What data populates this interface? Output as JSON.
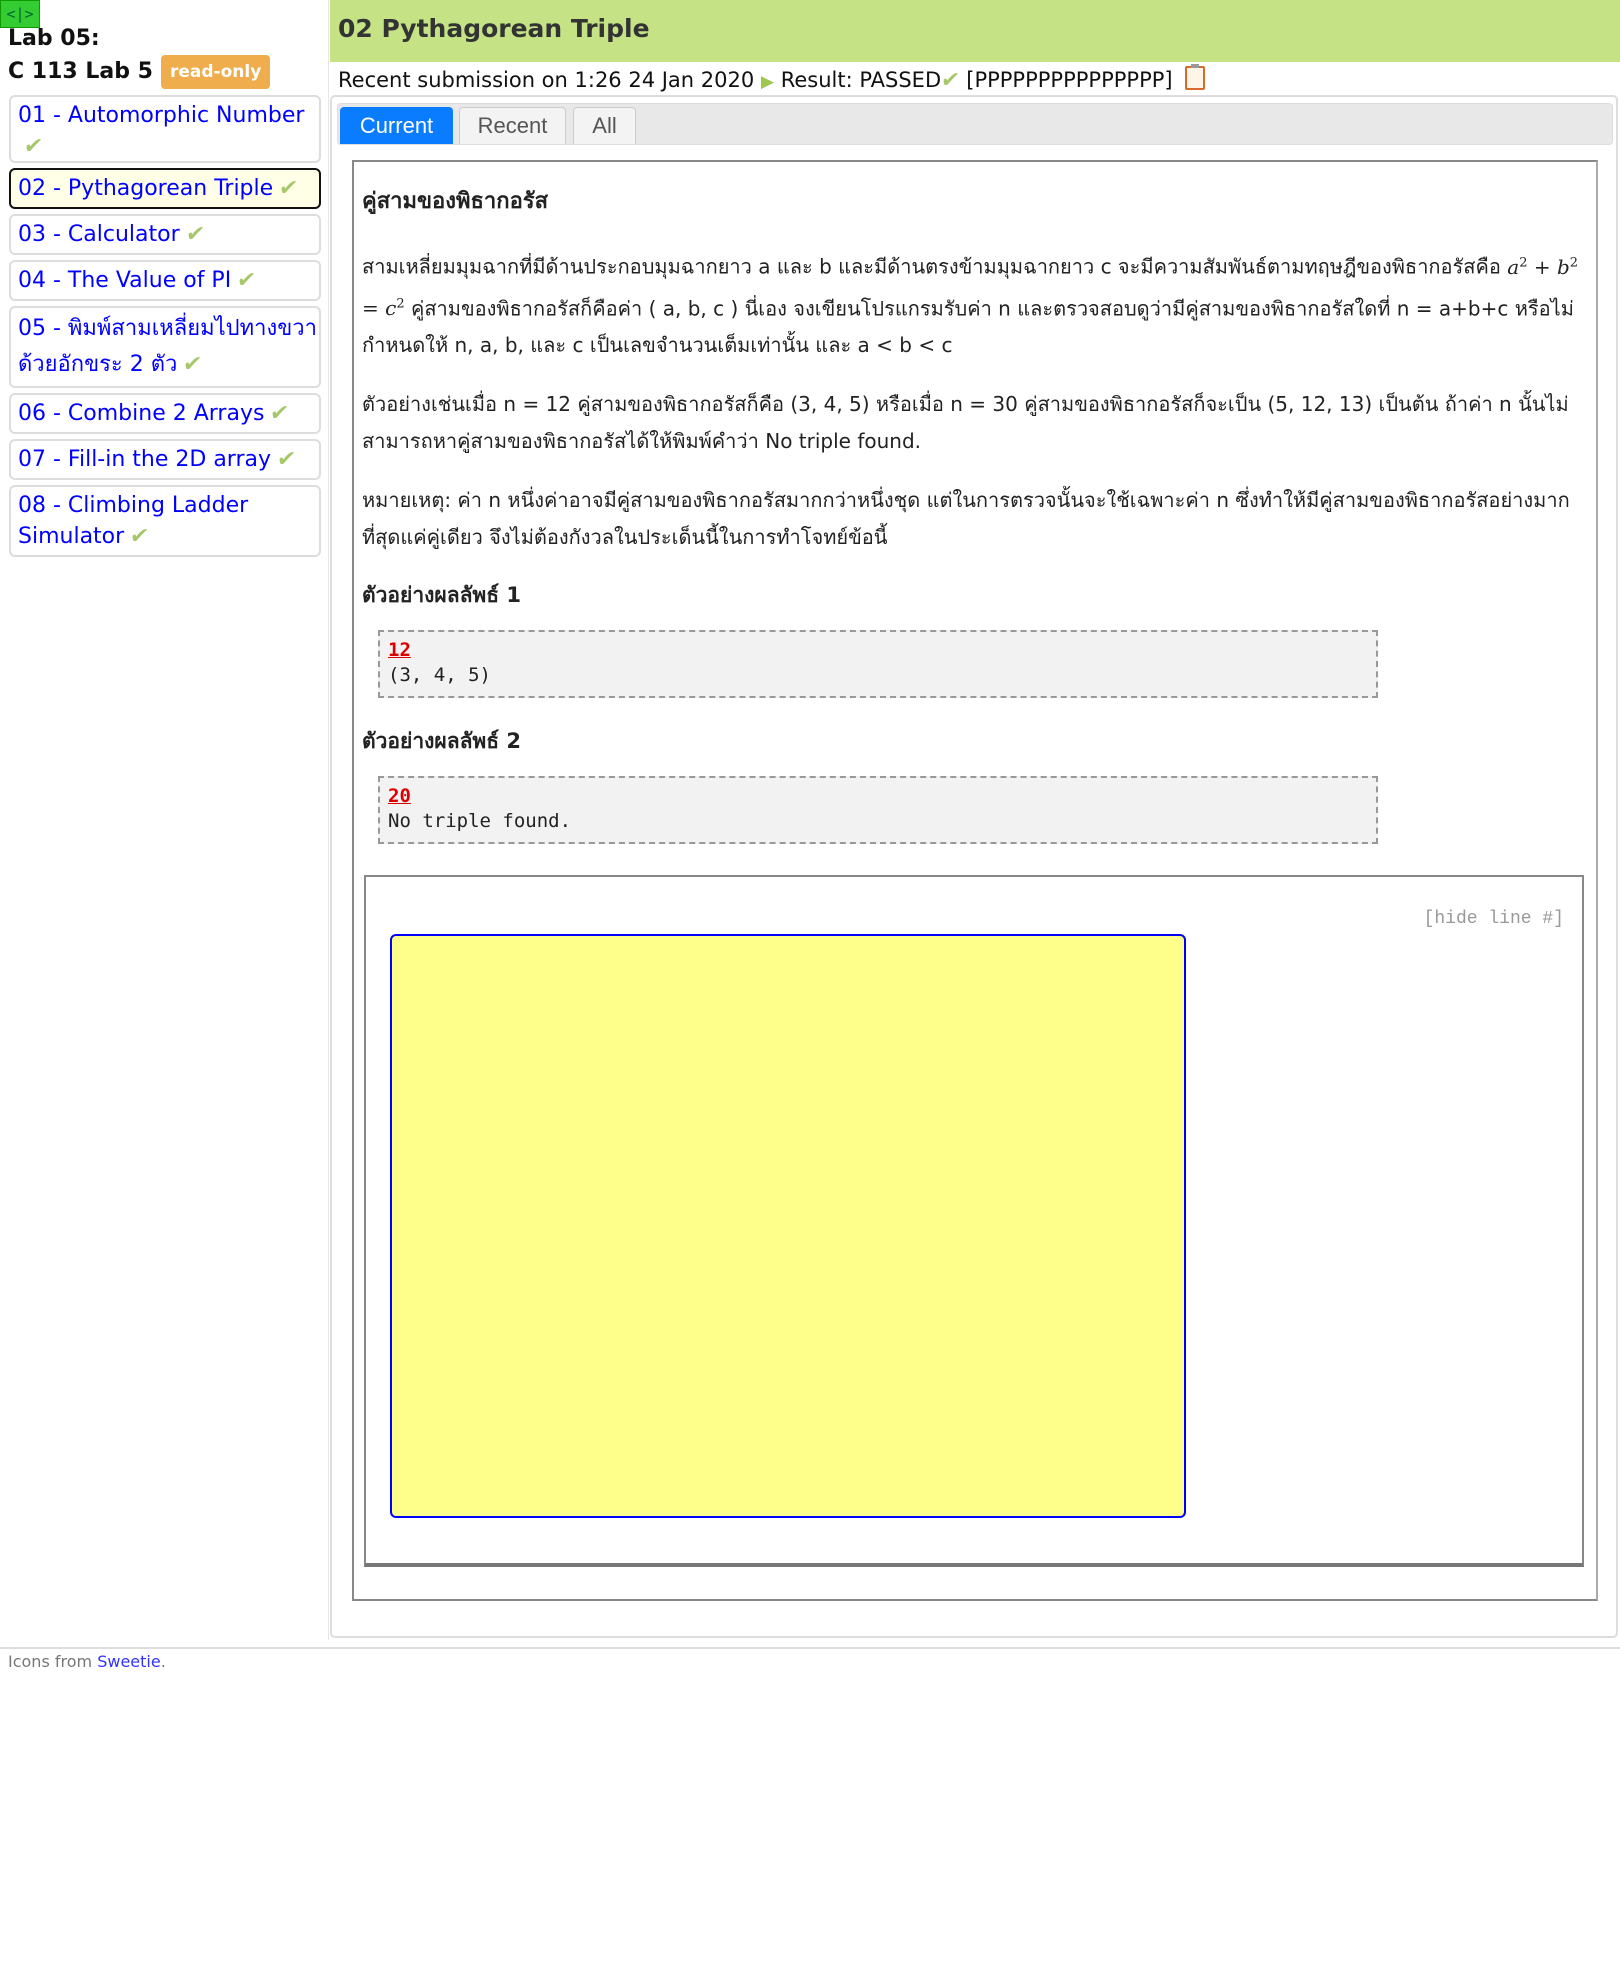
{
  "toggle": "<|>",
  "lab": {
    "title": "Lab 05:",
    "course": "C 113 Lab 5",
    "badge": "read-only"
  },
  "sidebar": {
    "items": [
      {
        "label": "01 - Automorphic Number",
        "passed": true
      },
      {
        "label": "02 - Pythagorean Triple",
        "passed": true,
        "active": true
      },
      {
        "label": "03 - Calculator",
        "passed": true
      },
      {
        "label": "04 - The Value of PI",
        "passed": true
      },
      {
        "label": "05 - พิมพ์สามเหลี่ยมไปทางขวาด้วยอักขระ 2 ตัว",
        "passed": true
      },
      {
        "label": "06 - Combine 2 Arrays",
        "passed": true
      },
      {
        "label": "07 - Fill-in the 2D array",
        "passed": true
      },
      {
        "label": "08 - Climbing Ladder Simulator",
        "passed": true
      }
    ]
  },
  "header": {
    "title": "02 Pythagorean Triple"
  },
  "submission": {
    "prefix": "Recent submission on 1:26 24 Jan 2020",
    "result": "Result: PASSED",
    "codes": "[PPPPPPPPPPPPPPP]"
  },
  "tabs": [
    "Current",
    "Recent",
    "All"
  ],
  "problem": {
    "heading": "คู่สามของพิธากอรัส",
    "p1_a": "สามเหลี่ยมมุมฉากที่มีด้านประกอบมุมฉากยาว a และ b และมีด้านตรงข้ามมุมฉากยาว c จะมีความสัมพันธ์ตามทฤษฎีของพิธากอรัสคือ",
    "p1_b": "คู่สามของพิธากอรัสก็คือค่า ( a, b, c ) นี่เอง จงเขียนโปรแกรมรับค่า n และตรวจสอบดูว่ามีคู่สามของพิธากอรัสใดที่ n = a+b+c หรือไม่ กำหนดให้ n, a, b, และ c เป็นเลขจำนวนเต็มเท่านั้น และ a < b < c",
    "p2": "ตัวอย่างเช่นเมื่อ n = 12 คู่สามของพิธากอรัสก็คือ (3, 4, 5) หรือเมื่อ n = 30 คู่สามของพิธากอรัสก็จะเป็น (5, 12, 13) เป็นต้น ถ้าค่า n นั้นไม่สามารถหาคู่สามของพิธากอรัสได้ให้พิมพ์คำว่า No triple found.",
    "p3": "หมายเหตุ: ค่า n หนึ่งค่าอาจมีคู่สามของพิธากอรัสมากกว่าหนึ่งชุด แต่ในการตรวจนั้นจะใช้เฉพาะค่า n ซึ่งทำให้มีคู่สามของพิธากอรัสอย่างมากที่สุดแค่คู่เดียว จึงไม่ต้องกังวลในประเด็นนี้ในการทำโจทย์ข้อนี้",
    "samples": [
      {
        "title": "ตัวอย่างผลลัพธ์ 1",
        "input": "12",
        "output": "(3, 4, 5)"
      },
      {
        "title": "ตัวอย่างผลลัพธ์ 2",
        "input": "20",
        "output": "No triple found."
      }
    ]
  },
  "code": {
    "hide_line_numbers": "[hide line #]"
  },
  "footer": {
    "prefix": "Icons from",
    "link": "Sweetie",
    "suffix": "."
  }
}
